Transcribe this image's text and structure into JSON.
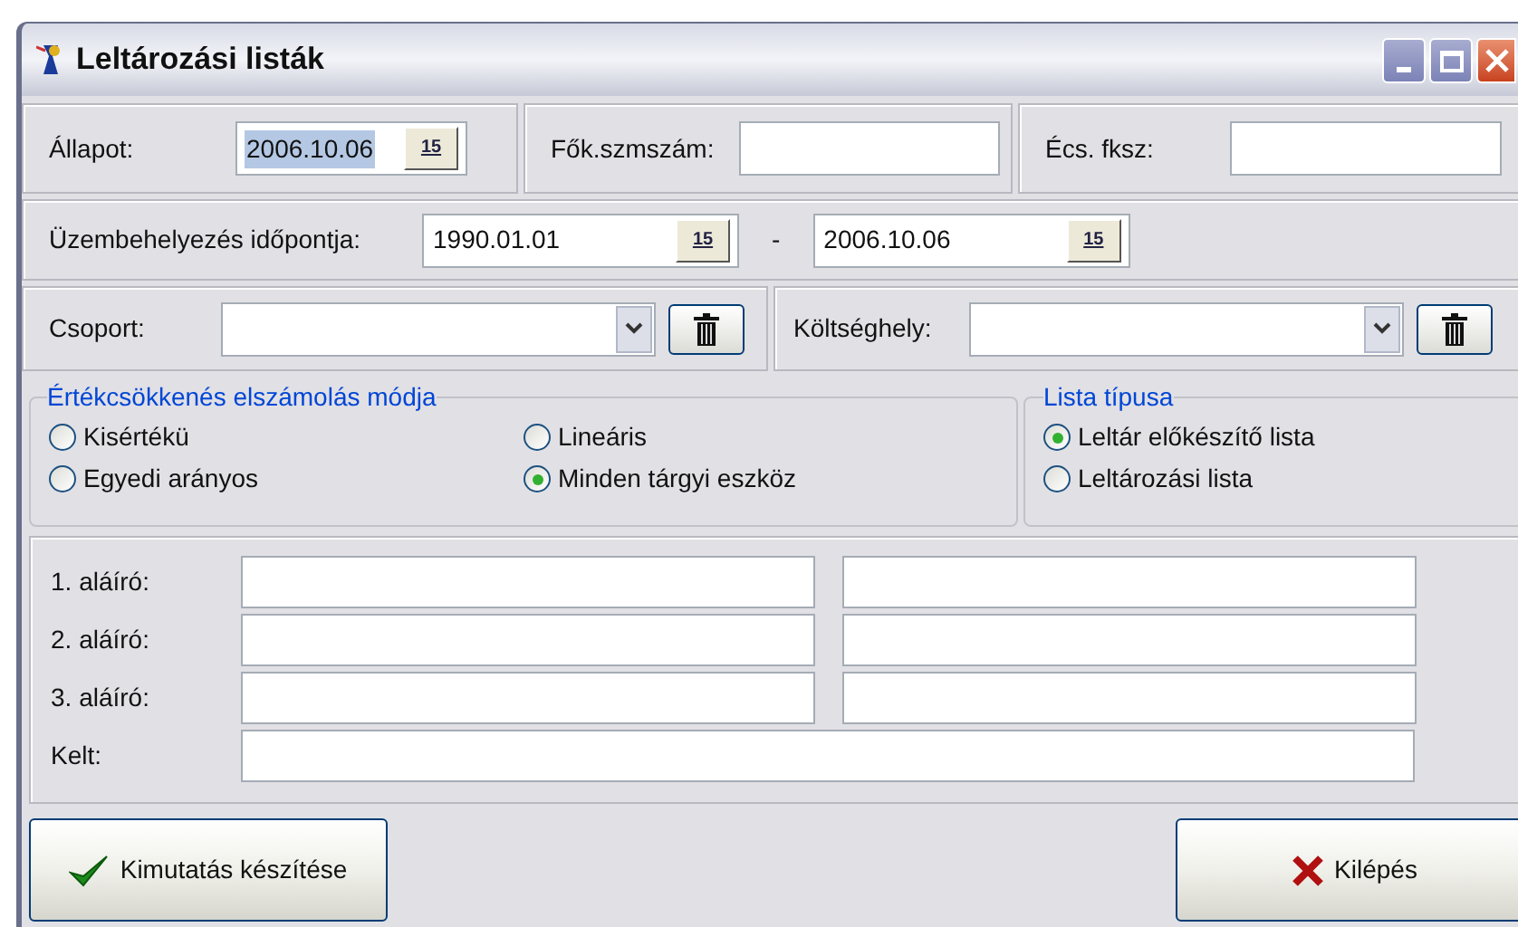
{
  "window": {
    "title": "Leltározási listák"
  },
  "row1": [
    {
      "label": "Állapot:",
      "value": "2006.10.06",
      "kind": "date",
      "button": "15",
      "highlighted": true
    },
    {
      "label": "Fők.szmszám:",
      "kind": "text"
    },
    {
      "label": "Écs. fksz:",
      "kind": "text"
    }
  ],
  "period": {
    "label": "Üzembehelyezés időpontja:",
    "from": {
      "value": "1990.01.01",
      "button": "15"
    },
    "separator": "-",
    "to": {
      "value": "2006.10.06",
      "button": "15"
    }
  },
  "lookups": [
    {
      "label": "Csoport:"
    },
    {
      "label": "Költséghely:"
    }
  ],
  "depreciation": {
    "title": "Értékcsökkenés elszámolás módja",
    "options": [
      {
        "label": "Kisértékü",
        "selected": false
      },
      {
        "label": "Egyedi arányos",
        "selected": false
      },
      {
        "label": "Lineáris",
        "selected": false
      },
      {
        "label": "Minden tárgyi eszköz",
        "selected": true
      }
    ]
  },
  "list_type": {
    "title": "Lista típusa",
    "options": [
      {
        "label": "Leltár előkészítő lista",
        "selected": true
      },
      {
        "label": "Leltározási lista",
        "selected": false
      }
    ]
  },
  "signers": [
    {
      "label": "1. aláíró:"
    },
    {
      "label": "2. aláíró:"
    },
    {
      "label": "3. aláíró:"
    }
  ],
  "date_field": {
    "label": "Kelt:"
  },
  "buttons": [
    {
      "label": "Kimutatás készítése",
      "kind": "confirm"
    },
    {
      "label": "Kilépés",
      "kind": "exit"
    }
  ]
}
